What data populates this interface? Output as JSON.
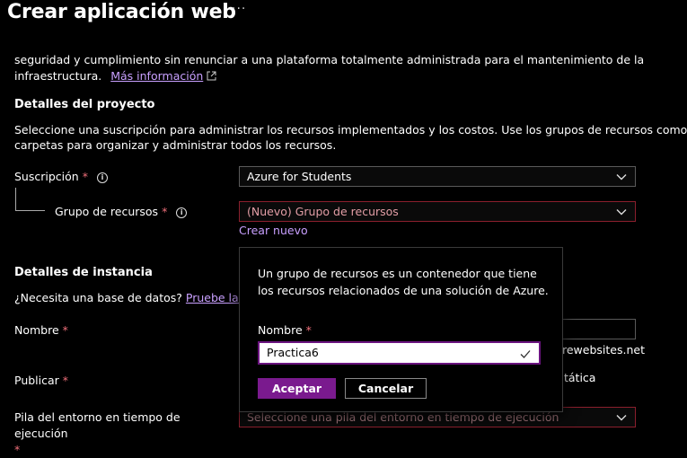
{
  "header": {
    "title": "Crear aplicación web",
    "more_label": "···"
  },
  "intro": {
    "text_top": "seguridad y cumplimiento sin renunciar a una plataforma totalmente administrada para el mantenimiento de la",
    "text_bottom": "infraestructura.",
    "more_info_link": "Más información"
  },
  "project": {
    "heading": "Detalles del proyecto",
    "desc_line1": "Seleccione una suscripción para administrar los recursos implementados y los costos. Use los grupos de recursos como",
    "desc_line2": "carpetas para organizar y administrar todos los recursos.",
    "subscription": {
      "label": "Suscripción",
      "required": "*",
      "value": "Azure for Students"
    },
    "resource_group": {
      "label": "Grupo de recursos",
      "required": "*",
      "value": "(Nuevo) Grupo de recursos"
    },
    "create_new_link": "Crear nuevo"
  },
  "instance": {
    "heading": "Detalles de instancia",
    "db_question": "¿Necesita una base de datos?",
    "db_link": "Pruebe la nue",
    "name_label": "Nombre",
    "name_required": "*",
    "domain_suffix": "rewebsites.net",
    "publish_label": "Publicar",
    "publish_required": "*",
    "publish_option_fragment": "tática",
    "runtime_label": "Pila del entorno en tiempo de ejecución",
    "runtime_required": "*",
    "runtime_placeholder": "Seleccione una pila del entorno en tiempo de ejecución"
  },
  "popup": {
    "description_line1": "Un grupo de recursos es un contenedor que tiene",
    "description_line2": "los recursos relacionados de una solución de Azure.",
    "name_label": "Nombre",
    "name_required": "*",
    "name_value": "Practica6",
    "accept_label": "Aceptar",
    "cancel_label": "Cancelar"
  },
  "colors": {
    "background": "#000000",
    "link": "#c9a0ff",
    "required": "#f1707b",
    "primary_button": "#7a1a8e",
    "invalid_border": "#8b1f2d"
  }
}
